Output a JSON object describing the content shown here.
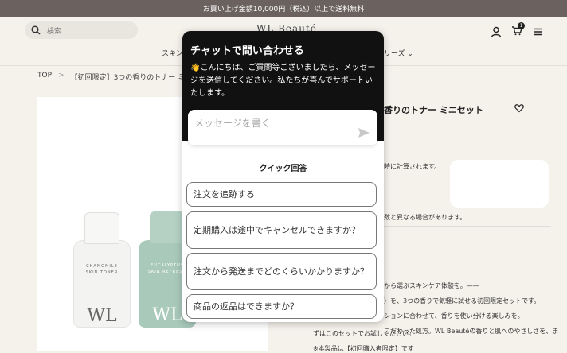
{
  "announcement": "お買い上げ金額10,000円（税込）以上で送料無料",
  "header": {
    "search_placeholder": "検索",
    "logo": "WL Beauté",
    "cart_count": "1",
    "nav_left": "スキンケ",
    "nav_right": "リーズ ⌄"
  },
  "breadcrumb": {
    "home": "TOP",
    "sep": ">",
    "current": "【初回限定】3つの香りのトナー ミニセット"
  },
  "gallery": {
    "bottle1_label": "CHAMOMILE\nSKIN TONER",
    "bottle1_brand": "WL",
    "bottle2_label": "EUCALYPTUS\nSKIN REFRESH",
    "bottle2_brand": "WL"
  },
  "product": {
    "title_fragment": "香りのトナー ミニセット",
    "tax_fragment": "時に計算されます。",
    "note_fragment": "数と異なる場合があります。",
    "desc_fragment": "から選ぶスキンケア体験を。——",
    "desc_line2": "）を、3つの香りで気軽に試せる初回限定セットです。",
    "desc_line3": "ションに合わせて、香りを使い分ける楽しみを。",
    "desc_line4": "こだわった処方。WL Beautéの香りと肌へのやさしさを、ま",
    "desc_line5": "ずはこのセットでお試しください。",
    "desc_line6": "※本製品は【初回購入者限定】です"
  },
  "chat": {
    "title": "チャットで問い合わせる",
    "greeting": "👋こんにちは、ご質問等ございましたら、メッセージを送信してください。私たちが喜んでサポートいたします。",
    "message_placeholder": "メッセージを書く",
    "quick_title": "クイック回答",
    "quick_replies": [
      "注文を追跡する",
      "定期購入は途中でキャンセルできますか？",
      "注文から発送までどのくらいかかりますか？",
      "商品の返品はできますか？"
    ]
  }
}
